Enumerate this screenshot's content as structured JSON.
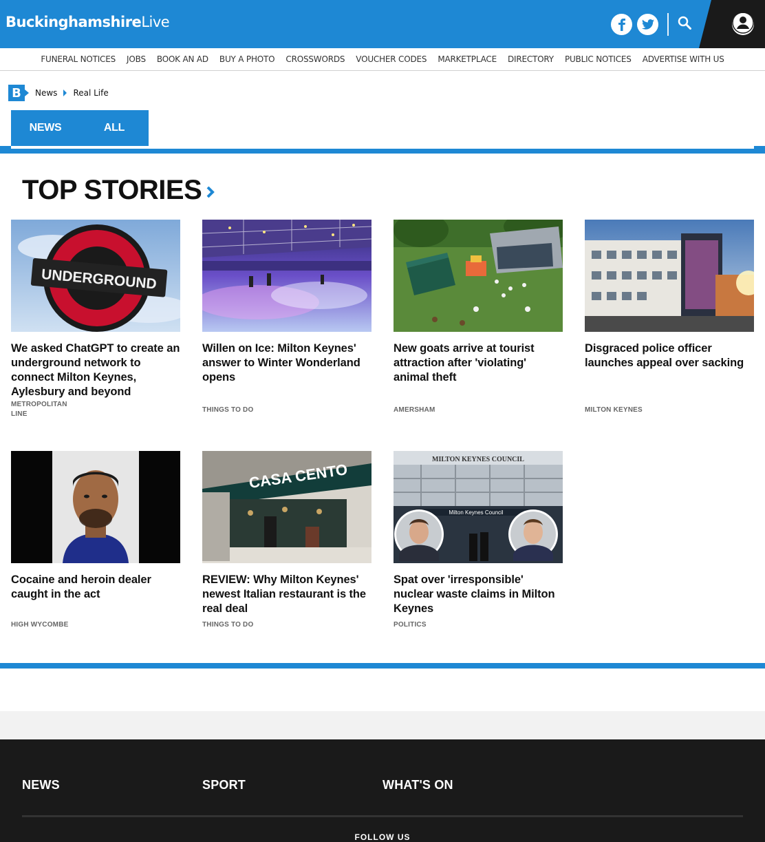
{
  "header": {
    "logo_bold": "Buckinghamshire",
    "logo_light": "Live",
    "facebook_icon": "facebook-icon",
    "twitter_icon": "twitter-icon",
    "search_icon": "search-icon",
    "account_icon": "user-icon",
    "brand_color": "#1e88d4"
  },
  "nav": {
    "items": [
      "FUNERAL NOTICES",
      "JOBS",
      "BOOK AN AD",
      "BUY A PHOTO",
      "CROSSWORDS",
      "VOUCHER CODES",
      "MARKETPLACE",
      "DIRECTORY",
      "PUBLIC NOTICES",
      "ADVERTISE WITH US"
    ]
  },
  "breadcrumb": {
    "badge": "B",
    "items": [
      "News",
      "Real Life"
    ]
  },
  "tabs": [
    "NEWS",
    "ALL"
  ],
  "top_stories": {
    "title": "TOP STORIES",
    "cards": [
      {
        "headline": "We asked ChatGPT to create an underground network to connect Milton Keynes, Aylesbury and beyond",
        "tag": "METROPOLITAN LINE"
      },
      {
        "headline": "Willen on Ice: Milton Keynes' answer to Winter Wonderland opens",
        "tag": "THINGS TO DO"
      },
      {
        "headline": "New goats arrive at tourist attraction after 'violating' animal theft",
        "tag": "AMERSHAM"
      },
      {
        "headline": "Disgraced police officer launches appeal over sacking",
        "tag": "MILTON KEYNES"
      },
      {
        "headline": "Cocaine and heroin dealer caught in the act",
        "tag": "HIGH WYCOMBE"
      },
      {
        "headline": "REVIEW: Why Milton Keynes' newest Italian restaurant is the real deal",
        "tag": "THINGS TO DO"
      },
      {
        "headline": "Spat over 'irresponsible' nuclear waste claims in Milton Keynes",
        "tag": "POLITICS"
      }
    ],
    "image_text": {
      "underground_sign": "UNDERGROUND",
      "restaurant_sign": "CASA CENTO",
      "council_sign": "MILTON KEYNES COUNCIL",
      "council_banner": "Milton Keynes Council"
    }
  },
  "footer": {
    "columns": [
      "NEWS",
      "SPORT",
      "WHAT'S ON"
    ],
    "follow": "FOLLOW US"
  }
}
